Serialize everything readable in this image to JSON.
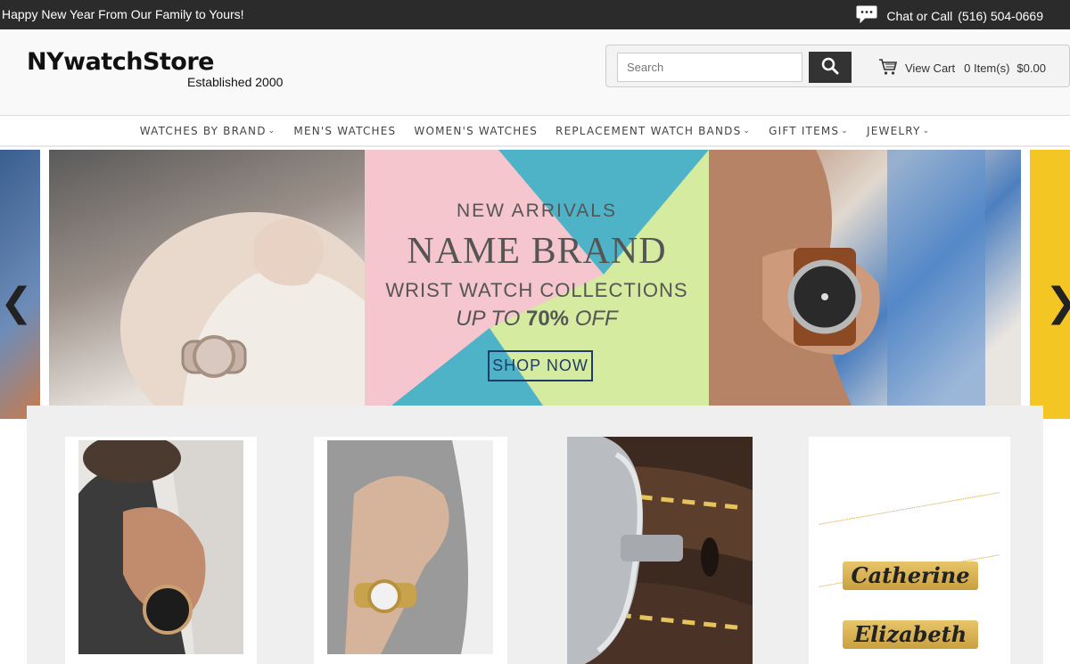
{
  "topbar": {
    "promo": "Happy New Year From Our Family to Yours!",
    "chat_label": "Chat or Call",
    "phone": "(516) 504-0669"
  },
  "header": {
    "logo_name": "NYwatchStore",
    "logo_tagline": "Established 2000",
    "search_placeholder": "Search",
    "cart_label": "View Cart",
    "cart_items": "0 Item(s)",
    "cart_total": "$0.00"
  },
  "nav": {
    "items": [
      {
        "label": "WATCHES BY BRAND",
        "caret": "⌄"
      },
      {
        "label": "MEN'S WATCHES",
        "caret": ""
      },
      {
        "label": "WOMEN'S WATCHES",
        "caret": ""
      },
      {
        "label": "REPLACEMENT WATCH BANDS",
        "caret": "⌄"
      },
      {
        "label": "GIFT ITEMS",
        "caret": "⌄"
      },
      {
        "label": "JEWELRY",
        "caret": "⌄"
      }
    ]
  },
  "hero": {
    "line1": "NEW ARRIVALS",
    "line2": "NAME BRAND",
    "line3": "WRIST WATCH COLLECTIONS",
    "line4_pre": "UP TO ",
    "line4_bold": "70%",
    "line4_post": " OFF",
    "cta": "SHOP NOW",
    "prev_arrow": "❮",
    "next_arrow": "❯"
  },
  "tiles": {
    "nameplate1": "Catherine",
    "nameplate2": "Elizabeth"
  },
  "colors": {
    "topbar_bg": "#2b2b2b",
    "accent_navy": "#1f3a6b",
    "hero_pink": "#f5c6cd",
    "hero_teal": "#4fb3c8",
    "hero_lime": "#d4eba0"
  }
}
